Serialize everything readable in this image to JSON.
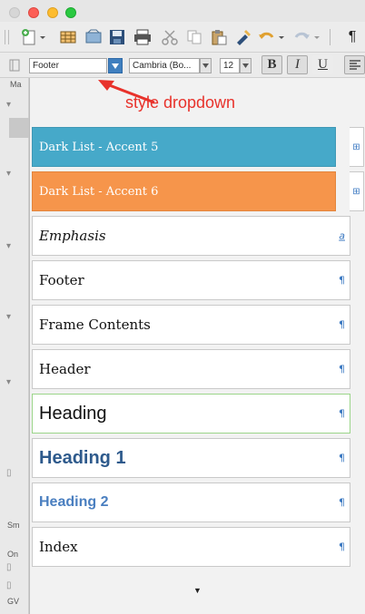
{
  "window": {
    "traffic_lights": [
      "close",
      "minimize",
      "zoom"
    ]
  },
  "toolbar": {
    "icons": [
      "new-document-icon",
      "table-icon",
      "gallery-icon",
      "save-icon",
      "print-icon",
      "cut-icon",
      "copy-icon",
      "paste-icon",
      "format-painter-icon",
      "undo-icon",
      "redo-icon",
      "pilcrow-icon"
    ]
  },
  "format_bar": {
    "style_value": "Footer",
    "font_value": "Cambria (Bo...",
    "size_value": "12",
    "bold_label": "B",
    "italic_label": "I",
    "underline_label": "U"
  },
  "sidebar": {
    "labels": [
      "Ma",
      "Sm",
      "On",
      "GV"
    ]
  },
  "annotation": {
    "text": "style dropdown",
    "color": "#e8322b"
  },
  "style_dropdown": {
    "items": [
      {
        "label": "Dark List - Accent 5",
        "mark": "⊞",
        "bg": "#46a9c9"
      },
      {
        "label": "Dark List - Accent 6",
        "mark": "⊞",
        "bg": "#f6954b"
      },
      {
        "label": "Emphasis",
        "mark": "a"
      },
      {
        "label": "Footer",
        "mark": "¶"
      },
      {
        "label": "Frame Contents",
        "mark": "¶"
      },
      {
        "label": "Header",
        "mark": "¶"
      },
      {
        "label": "Heading",
        "mark": "¶"
      },
      {
        "label": "Heading 1",
        "mark": "¶"
      },
      {
        "label": "Heading 2",
        "mark": "¶"
      },
      {
        "label": "Index",
        "mark": "¶"
      }
    ],
    "scroll_down_glyph": "▼"
  }
}
